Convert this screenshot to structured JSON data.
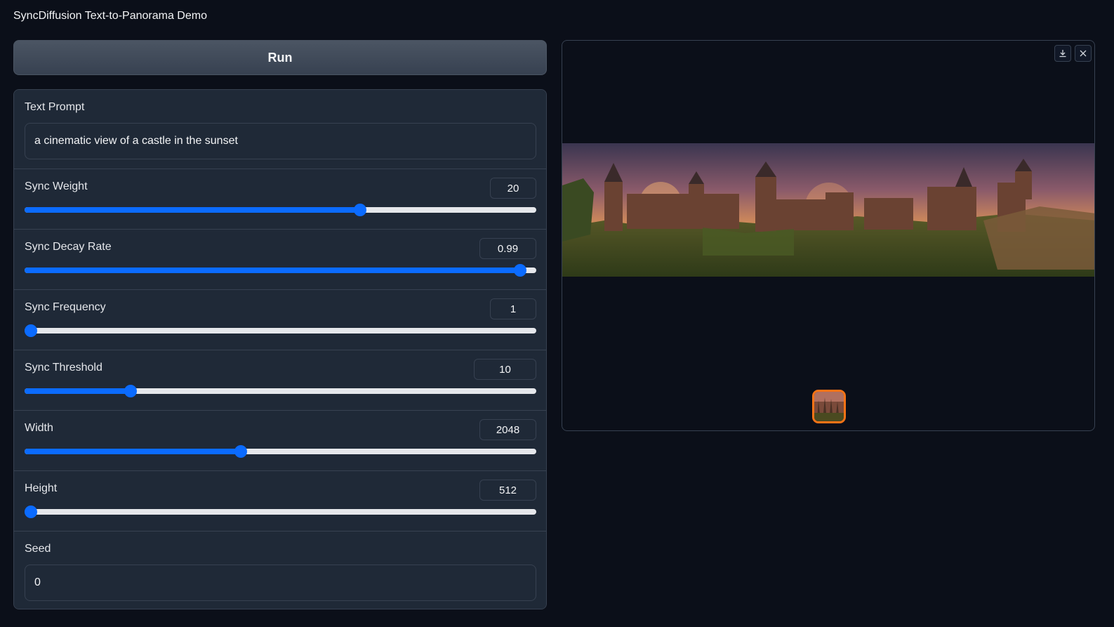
{
  "app": {
    "title": "SyncDiffusion Text-to-Panorama Demo"
  },
  "run_button": {
    "label": "Run"
  },
  "prompt": {
    "label": "Text Prompt",
    "value": "a cinematic view of a castle in the sunset"
  },
  "sliders": [
    {
      "key": "sync_weight",
      "label": "Sync Weight",
      "value": "20",
      "fraction": 0.66
    },
    {
      "key": "sync_decay_rate",
      "label": "Sync Decay Rate",
      "value": "0.99",
      "fraction": 0.98
    },
    {
      "key": "sync_frequency",
      "label": "Sync Frequency",
      "value": "1",
      "fraction": 0.0
    },
    {
      "key": "sync_threshold",
      "label": "Sync Threshold",
      "value": "10",
      "fraction": 0.2
    },
    {
      "key": "width",
      "label": "Width",
      "value": "2048",
      "fraction": 0.42
    },
    {
      "key": "height",
      "label": "Height",
      "value": "512",
      "fraction": 0.0
    }
  ],
  "seed": {
    "label": "Seed",
    "value": "0"
  },
  "gallery": {
    "download_icon": "download-icon",
    "close_icon": "close-icon",
    "image_subject": "castle panorama at sunset"
  },
  "colors": {
    "accent": "#0b6bff",
    "selected_border": "#f97316",
    "background": "#0b0f19",
    "panel": "#1f2937"
  }
}
